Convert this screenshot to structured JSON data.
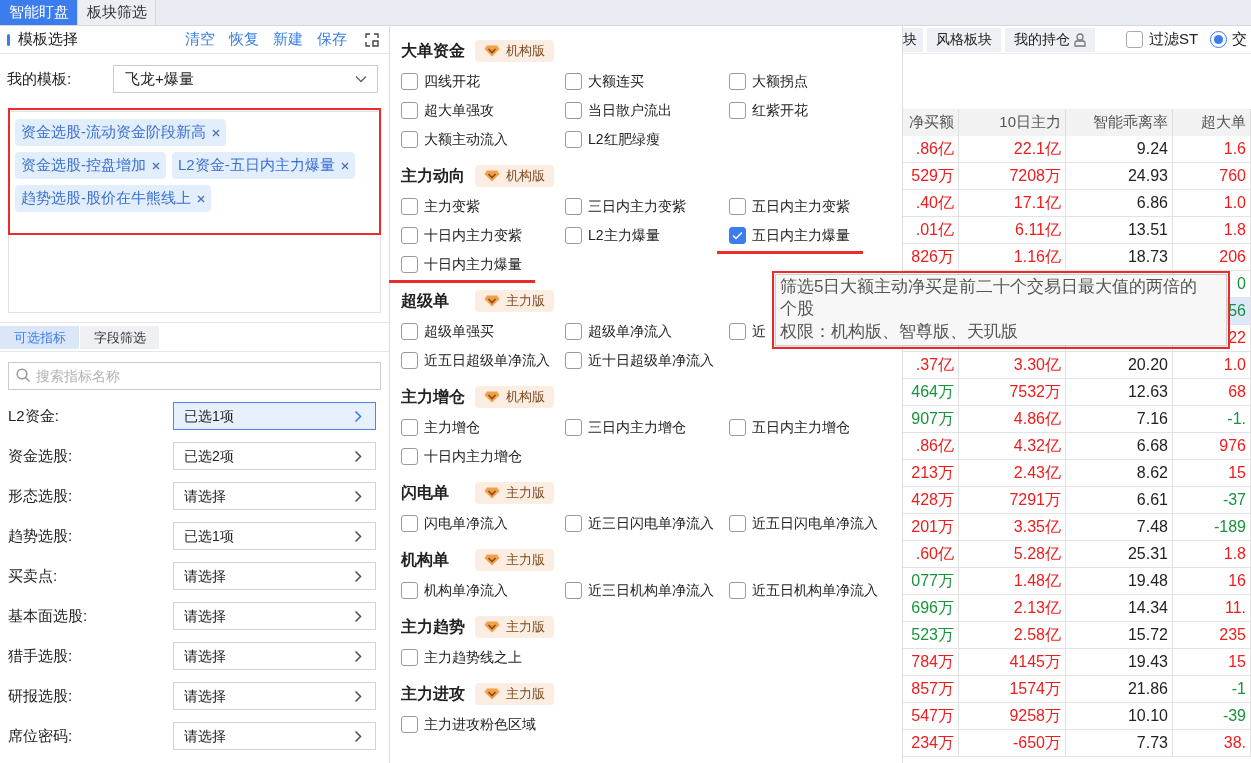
{
  "top_tabs": [
    {
      "label": "智能盯盘",
      "selected": true
    },
    {
      "label": "板块筛选",
      "selected": false
    }
  ],
  "template_panel": {
    "title": "模板选择",
    "actions": [
      "清空",
      "恢复",
      "新建",
      "保存"
    ],
    "my_template": {
      "label": "我的模板:",
      "value": "飞龙+爆量"
    },
    "tag_area": {
      "highlighted": true,
      "tags": [
        "资金选股-流动资金阶段新高",
        "资金选股-控盘增加",
        "L2资金-五日内主力爆量",
        "趋势选股-股价在牛熊线上"
      ]
    }
  },
  "indicator_tabs": [
    {
      "label": "可选指标",
      "selected": true
    },
    {
      "label": "字段筛选",
      "selected": false
    }
  ],
  "search": {
    "placeholder": "搜索指标名称"
  },
  "pickers": [
    {
      "label": "L2资金:",
      "value": "已选1项",
      "selected": true
    },
    {
      "label": "资金选股:",
      "value": "已选2项",
      "selected": false
    },
    {
      "label": "形态选股:",
      "value": "请选择",
      "selected": false
    },
    {
      "label": "趋势选股:",
      "value": "已选1项",
      "selected": false
    },
    {
      "label": "买卖点:",
      "value": "请选择",
      "selected": false
    },
    {
      "label": "基本面选股:",
      "value": "请选择",
      "selected": false
    },
    {
      "label": "猎手选股:",
      "value": "请选择",
      "selected": false
    },
    {
      "label": "研报选股:",
      "value": "请选择",
      "selected": false
    },
    {
      "label": "席位密码:",
      "value": "请选择",
      "selected": false
    }
  ],
  "popup": {
    "sections": [
      {
        "title": "大单资金",
        "badge": "机构版",
        "items": [
          {
            "label": "四线开花",
            "checked": false,
            "underlined": false
          },
          {
            "label": "大额连买",
            "checked": false,
            "underlined": false
          },
          {
            "label": "大额拐点",
            "checked": false,
            "underlined": false
          },
          {
            "label": "超大单强攻",
            "checked": false,
            "underlined": false
          },
          {
            "label": "当日散户流出",
            "checked": false,
            "underlined": false
          },
          {
            "label": "红紫开花",
            "checked": false,
            "underlined": false
          },
          {
            "label": "大额主动流入",
            "checked": false,
            "underlined": false
          },
          {
            "label": "L2红肥绿瘦",
            "checked": false,
            "underlined": false
          }
        ]
      },
      {
        "title": "主力动向",
        "badge": "机构版",
        "items": [
          {
            "label": "主力变紫",
            "checked": false,
            "underlined": false
          },
          {
            "label": "三日内主力变紫",
            "checked": false,
            "underlined": false
          },
          {
            "label": "五日内主力变紫",
            "checked": false,
            "underlined": false
          },
          {
            "label": "十日内主力变紫",
            "checked": false,
            "underlined": false
          },
          {
            "label": "L2主力爆量",
            "checked": false,
            "underlined": false
          },
          {
            "label": "五日内主力爆量",
            "checked": true,
            "underlined": true
          },
          {
            "label": "十日内主力爆量",
            "checked": false,
            "underlined": true
          }
        ]
      },
      {
        "title": "超级单",
        "badge": "主力版",
        "items": [
          {
            "label": "超级单强买",
            "checked": false,
            "underlined": false
          },
          {
            "label": "超级单净流入",
            "checked": false,
            "underlined": false
          },
          {
            "label": "近",
            "checked": false,
            "underlined": false
          },
          {
            "label": "近五日超级单净流入",
            "checked": false,
            "underlined": false
          },
          {
            "label": "近十日超级单净流入",
            "checked": false,
            "underlined": false
          }
        ]
      },
      {
        "title": "主力增仓",
        "badge": "机构版",
        "items": [
          {
            "label": "主力增仓",
            "checked": false,
            "underlined": false
          },
          {
            "label": "三日内主力增仓",
            "checked": false,
            "underlined": false
          },
          {
            "label": "五日内主力增仓",
            "checked": false,
            "underlined": false
          },
          {
            "label": "十日内主力增仓",
            "checked": false,
            "underlined": false
          }
        ]
      },
      {
        "title": "闪电单",
        "badge": "主力版",
        "items": [
          {
            "label": "闪电单净流入",
            "checked": false,
            "underlined": false
          },
          {
            "label": "近三日闪电单净流入",
            "checked": false,
            "underlined": false
          },
          {
            "label": "近五日闪电单净流入",
            "checked": false,
            "underlined": false
          }
        ]
      },
      {
        "title": "机构单",
        "badge": "主力版",
        "items": [
          {
            "label": "机构单净流入",
            "checked": false,
            "underlined": false
          },
          {
            "label": "近三日机构单净流入",
            "checked": false,
            "underlined": false
          },
          {
            "label": "近五日机构单净流入",
            "checked": false,
            "underlined": false
          }
        ]
      },
      {
        "title": "主力趋势",
        "badge": "主力版",
        "items": [
          {
            "label": "主力趋势线之上",
            "checked": false,
            "underlined": false
          }
        ]
      },
      {
        "title": "主力进攻",
        "badge": "主力版",
        "items": [
          {
            "label": "主力进攻粉色区域",
            "checked": false,
            "underlined": false
          }
        ]
      }
    ]
  },
  "tooltip": {
    "highlighted": true,
    "description": "筛选5日大额主动净买是前二十个交易日最大值的两倍的个股",
    "permission": "权限：机构版、智尊版、天玑版"
  },
  "right_toolbar": {
    "tabs": [
      "块",
      "风格板块",
      "我的持仓"
    ],
    "filter_st": {
      "label": "过滤ST",
      "checked": false
    },
    "radio": {
      "label": "交",
      "selected": true
    }
  },
  "table": {
    "columns": [
      "净买额",
      "10日主力",
      "智能乖离率",
      "超大单"
    ],
    "rows": [
      {
        "selected": false,
        "cells": [
          {
            "text": ".86亿",
            "color": "#ee1c1c"
          },
          {
            "text": "22.1亿",
            "color": "#ee1c1c"
          },
          {
            "text": "9.24",
            "color": "#222222"
          },
          {
            "text": "1.6",
            "color": "#ee1c1c"
          }
        ]
      },
      {
        "selected": false,
        "cells": [
          {
            "text": "529万",
            "color": "#ee1c1c"
          },
          {
            "text": "7208万",
            "color": "#ee1c1c"
          },
          {
            "text": "24.93",
            "color": "#222222"
          },
          {
            "text": "760",
            "color": "#ee1c1c"
          }
        ]
      },
      {
        "selected": false,
        "cells": [
          {
            "text": ".40亿",
            "color": "#ee1c1c"
          },
          {
            "text": "17.1亿",
            "color": "#ee1c1c"
          },
          {
            "text": "6.86",
            "color": "#222222"
          },
          {
            "text": "1.0",
            "color": "#ee1c1c"
          }
        ]
      },
      {
        "selected": false,
        "cells": [
          {
            "text": ".01亿",
            "color": "#ee1c1c"
          },
          {
            "text": "6.11亿",
            "color": "#ee1c1c"
          },
          {
            "text": "13.51",
            "color": "#222222"
          },
          {
            "text": "1.8",
            "color": "#ee1c1c"
          }
        ]
      },
      {
        "selected": false,
        "cells": [
          {
            "text": "826万",
            "color": "#ee1c1c"
          },
          {
            "text": "1.16亿",
            "color": "#ee1c1c"
          },
          {
            "text": "18.73",
            "color": "#222222"
          },
          {
            "text": "206",
            "color": "#ee1c1c"
          }
        ]
      },
      {
        "selected": false,
        "cells": [
          null,
          null,
          null,
          {
            "text": "0",
            "color": "#15943c"
          }
        ]
      },
      {
        "selected": true,
        "cells": [
          null,
          null,
          null,
          {
            "text": "56",
            "color": "#15943c"
          }
        ]
      },
      {
        "selected": false,
        "cells": [
          null,
          null,
          null,
          {
            "text": "22",
            "color": "#ee1c1c"
          }
        ]
      },
      {
        "selected": false,
        "cells": [
          {
            "text": ".37亿",
            "color": "#ee1c1c"
          },
          {
            "text": "3.30亿",
            "color": "#ee1c1c"
          },
          {
            "text": "20.20",
            "color": "#222222"
          },
          {
            "text": "1.0",
            "color": "#ee1c1c"
          }
        ]
      },
      {
        "selected": false,
        "cells": [
          {
            "text": "464万",
            "color": "#15943c"
          },
          {
            "text": "7532万",
            "color": "#ee1c1c"
          },
          {
            "text": "12.63",
            "color": "#222222"
          },
          {
            "text": "68",
            "color": "#ee1c1c"
          }
        ]
      },
      {
        "selected": false,
        "cells": [
          {
            "text": "907万",
            "color": "#15943c"
          },
          {
            "text": "4.86亿",
            "color": "#ee1c1c"
          },
          {
            "text": "7.16",
            "color": "#222222"
          },
          {
            "text": "-1.",
            "color": "#15943c"
          }
        ]
      },
      {
        "selected": false,
        "cells": [
          {
            "text": ".86亿",
            "color": "#ee1c1c"
          },
          {
            "text": "4.32亿",
            "color": "#ee1c1c"
          },
          {
            "text": "6.68",
            "color": "#222222"
          },
          {
            "text": "976",
            "color": "#ee1c1c"
          }
        ]
      },
      {
        "selected": false,
        "cells": [
          {
            "text": "213万",
            "color": "#ee1c1c"
          },
          {
            "text": "2.43亿",
            "color": "#ee1c1c"
          },
          {
            "text": "8.62",
            "color": "#222222"
          },
          {
            "text": "15",
            "color": "#ee1c1c"
          }
        ]
      },
      {
        "selected": false,
        "cells": [
          {
            "text": "428万",
            "color": "#ee1c1c"
          },
          {
            "text": "7291万",
            "color": "#ee1c1c"
          },
          {
            "text": "6.61",
            "color": "#222222"
          },
          {
            "text": "-37",
            "color": "#15943c"
          }
        ]
      },
      {
        "selected": false,
        "cells": [
          {
            "text": "201万",
            "color": "#ee1c1c"
          },
          {
            "text": "3.35亿",
            "color": "#ee1c1c"
          },
          {
            "text": "7.48",
            "color": "#222222"
          },
          {
            "text": "-189",
            "color": "#15943c"
          }
        ]
      },
      {
        "selected": false,
        "cells": [
          {
            "text": ".60亿",
            "color": "#ee1c1c"
          },
          {
            "text": "5.28亿",
            "color": "#ee1c1c"
          },
          {
            "text": "25.31",
            "color": "#222222"
          },
          {
            "text": "1.8",
            "color": "#ee1c1c"
          }
        ]
      },
      {
        "selected": false,
        "cells": [
          {
            "text": "077万",
            "color": "#15943c"
          },
          {
            "text": "1.48亿",
            "color": "#ee1c1c"
          },
          {
            "text": "19.48",
            "color": "#222222"
          },
          {
            "text": "16",
            "color": "#ee1c1c"
          }
        ]
      },
      {
        "selected": false,
        "cells": [
          {
            "text": "696万",
            "color": "#15943c"
          },
          {
            "text": "2.13亿",
            "color": "#ee1c1c"
          },
          {
            "text": "14.34",
            "color": "#222222"
          },
          {
            "text": "11.",
            "color": "#ee1c1c"
          }
        ]
      },
      {
        "selected": false,
        "cells": [
          {
            "text": "523万",
            "color": "#15943c"
          },
          {
            "text": "2.58亿",
            "color": "#ee1c1c"
          },
          {
            "text": "15.72",
            "color": "#222222"
          },
          {
            "text": "235",
            "color": "#ee1c1c"
          }
        ]
      },
      {
        "selected": false,
        "cells": [
          {
            "text": "784万",
            "color": "#ee1c1c"
          },
          {
            "text": "4145万",
            "color": "#ee1c1c"
          },
          {
            "text": "19.43",
            "color": "#222222"
          },
          {
            "text": "15",
            "color": "#ee1c1c"
          }
        ]
      },
      {
        "selected": false,
        "cells": [
          {
            "text": "857万",
            "color": "#ee1c1c"
          },
          {
            "text": "1574万",
            "color": "#ee1c1c"
          },
          {
            "text": "21.86",
            "color": "#222222"
          },
          {
            "text": "-1",
            "color": "#15943c"
          }
        ]
      },
      {
        "selected": false,
        "cells": [
          {
            "text": "547万",
            "color": "#ee1c1c"
          },
          {
            "text": "9258万",
            "color": "#ee1c1c"
          },
          {
            "text": "10.10",
            "color": "#222222"
          },
          {
            "text": "-39",
            "color": "#15943c"
          }
        ]
      },
      {
        "selected": false,
        "cells": [
          {
            "text": "234万",
            "color": "#ee1c1c"
          },
          {
            "text": "-650万",
            "color": "#ee1c1c"
          },
          {
            "text": "7.73",
            "color": "#222222"
          },
          {
            "text": "38.",
            "color": "#ee1c1c"
          }
        ]
      }
    ]
  }
}
